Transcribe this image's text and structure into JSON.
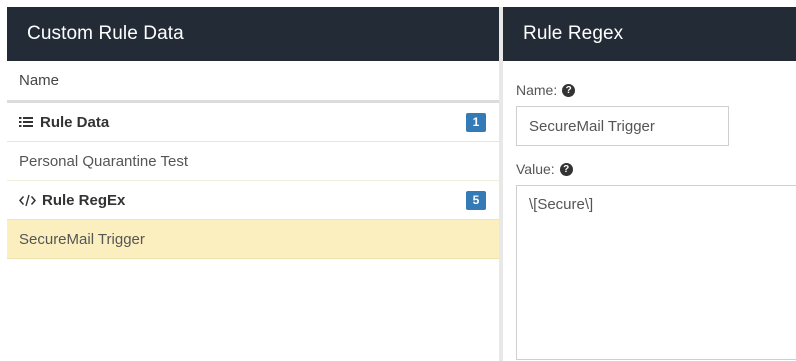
{
  "left_panel": {
    "title": "Custom Rule Data",
    "column_header": "Name",
    "groups": [
      {
        "label": "Rule Data",
        "icon": "list-icon",
        "count": "1",
        "items": [
          "Personal Quarantine Test"
        ]
      },
      {
        "label": "Rule RegEx",
        "icon": "code-icon",
        "count": "5",
        "items": [
          "SecureMail Trigger"
        ]
      }
    ],
    "selected_item": "SecureMail Trigger"
  },
  "right_panel": {
    "title": "Rule Regex",
    "name_label": "Name:",
    "name_value": "SecureMail Trigger",
    "value_label": "Value:",
    "value_value": "\\[Secure\\]",
    "help_icon": "question-circle-icon"
  },
  "colors": {
    "header_bg": "#222b36",
    "badge_bg": "#337ab7",
    "selected_row_bg": "#fcefbf"
  }
}
